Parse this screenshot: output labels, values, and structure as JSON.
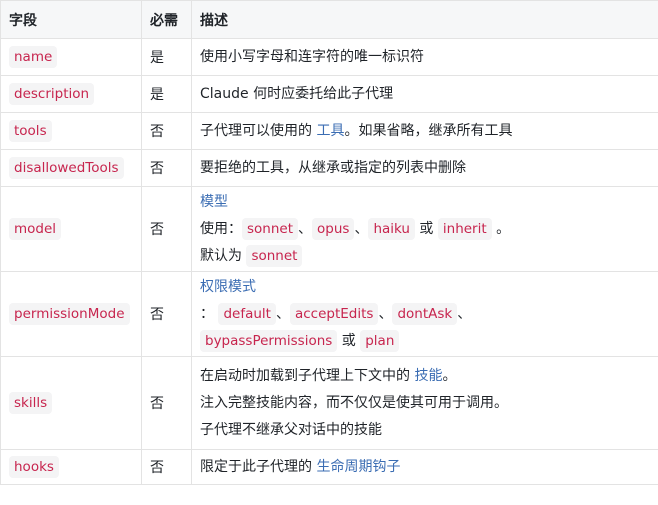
{
  "headers": {
    "field": "字段",
    "required": "必需",
    "description": "描述"
  },
  "rows": {
    "name": {
      "field": "name",
      "required": "是",
      "desc": "使用小写字母和连字符的唯一标识符"
    },
    "description": {
      "field": "description",
      "required": "是",
      "desc": "Claude 何时应委托给此子代理"
    },
    "tools": {
      "field": "tools",
      "required": "否",
      "desc_before": "子代理可以使用的 ",
      "link": "工具",
      "desc_after": "。如果省略，继承所有工具"
    },
    "disallowedTools": {
      "field": "disallowedTools",
      "required": "否",
      "desc": "要拒绝的工具，从继承或指定的列表中删除"
    },
    "model": {
      "field": "model",
      "required": "否",
      "link": "模型",
      "use_label": " 使用：",
      "opt1": "sonnet",
      "sep1": "、",
      "opt2": "opus",
      "sep2": "、",
      "opt3": "haiku",
      "or": " 或 ",
      "opt4": "inherit",
      "end": " 。",
      "default_label": "默认为 ",
      "default_value": "sonnet"
    },
    "permissionMode": {
      "field": "permissionMode",
      "required": "否",
      "link": "权限模式",
      "colon": " ：",
      "opt1": "default",
      "sep1": "、",
      "opt2": "acceptEdits",
      "sep2": "、",
      "opt3": "dontAsk",
      "sep3": "、",
      "opt4": "bypassPermissions",
      "or": " 或 ",
      "opt5": "plan"
    },
    "skills": {
      "field": "skills",
      "required": "否",
      "line1_before": "在启动时加载到子代理上下文中的 ",
      "link": "技能",
      "line1_after": "。",
      "line2": "注入完整技能内容，而不仅仅是使其可用于调用。",
      "line3": "子代理不继承父对话中的技能"
    },
    "hooks": {
      "field": "hooks",
      "required": "否",
      "desc_before": "限定于此子代理的 ",
      "link": "生命周期钩子"
    }
  },
  "colors": {
    "code_text": "#c7254e",
    "code_bg": "#f4f4f5",
    "link": "#3b6db3",
    "header_bg": "#f6f7f8",
    "border": "#e3e3e3"
  }
}
